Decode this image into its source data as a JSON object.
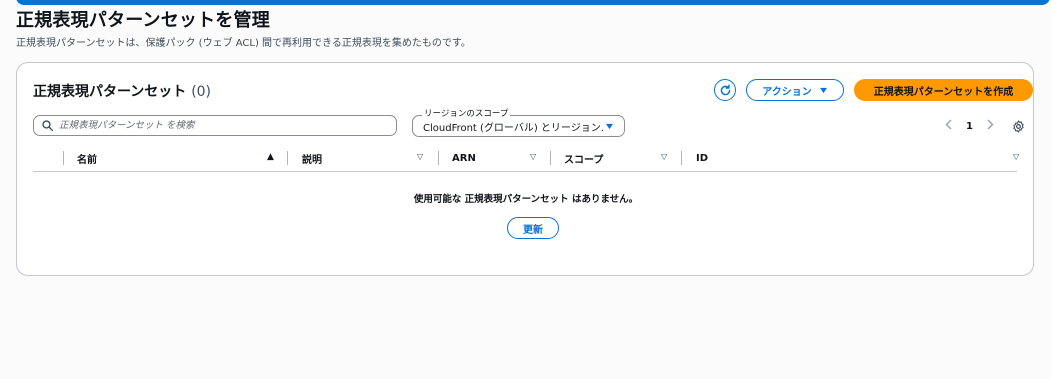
{
  "page": {
    "title": "正規表現パターンセットを管理",
    "description": "正規表現パターンセットは、保護パック (ウェブ ACL) 間で再利用できる正規表現を集めたものです。"
  },
  "panel": {
    "title": "正規表現パターンセット",
    "count": "(0)",
    "actions_label": "アクション",
    "create_label": "正規表現パターンセットを作成"
  },
  "search": {
    "placeholder": "正規表現パターンセット を検索",
    "value": ""
  },
  "scope": {
    "label": "リージョンのスコープ",
    "selected": "CloudFront (グローバル) とリージョン..."
  },
  "pagination": {
    "page": "1"
  },
  "table": {
    "columns": [
      "名前",
      "説明",
      "ARN",
      "スコープ",
      "ID"
    ],
    "empty_message": "使用可能な 正規表現パターンセット はありません。",
    "refresh_label": "更新"
  },
  "colors": {
    "accent": "#0972d3",
    "primary": "#ff9900",
    "border": "#c6c6cd"
  },
  "icons": [
    "refresh-icon",
    "caret-down-icon",
    "search-icon",
    "chevron-left-icon",
    "chevron-right-icon",
    "gear-icon",
    "sort-ascending-icon",
    "sort-descending-icon"
  ]
}
